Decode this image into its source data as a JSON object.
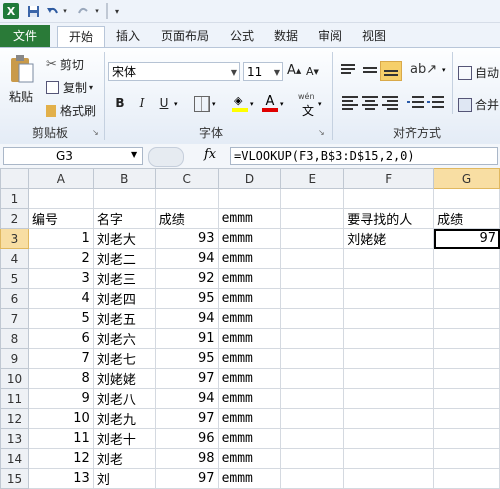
{
  "quick_access": {
    "logo": "X"
  },
  "tabs": [
    "文件",
    "开始",
    "插入",
    "页面布局",
    "公式",
    "数据",
    "审阅",
    "视图"
  ],
  "ribbon": {
    "clipboard": {
      "paste": "粘贴",
      "cut": "剪切",
      "copy": "复制",
      "format_painter": "格式刷",
      "group": "剪贴板"
    },
    "font": {
      "name": "宋体",
      "size": "11",
      "grow": "A",
      "shrink": "A",
      "bold": "B",
      "italic": "I",
      "underline": "U",
      "color_a": "A",
      "wen": "wén",
      "group": "字体"
    },
    "alignment": {
      "autowrap": "自动",
      "merge": "合并",
      "group": "对齐方式"
    }
  },
  "formula_bar": {
    "name_box": "G3",
    "fx": "fx",
    "formula": "=VLOOKUP(F3,B$3:D$15,2,0)"
  },
  "columns": [
    "A",
    "B",
    "C",
    "D",
    "E",
    "F",
    "G"
  ],
  "rows": [
    {
      "n": "1",
      "A": "",
      "B": "",
      "C": "",
      "D": "",
      "F": "",
      "G": ""
    },
    {
      "n": "2",
      "A": "编号",
      "B": "名字",
      "C": "成绩",
      "D": "emmm",
      "F": "要寻找的人",
      "G": "成绩"
    },
    {
      "n": "3",
      "A": "1",
      "B": "刘老大",
      "C": "93",
      "D": "emmm",
      "F": "刘姥姥",
      "G": "97"
    },
    {
      "n": "4",
      "A": "2",
      "B": "刘老二",
      "C": "94",
      "D": "emmm",
      "F": "",
      "G": ""
    },
    {
      "n": "5",
      "A": "3",
      "B": "刘老三",
      "C": "92",
      "D": "emmm",
      "F": "",
      "G": ""
    },
    {
      "n": "6",
      "A": "4",
      "B": "刘老四",
      "C": "95",
      "D": "emmm",
      "F": "",
      "G": ""
    },
    {
      "n": "7",
      "A": "5",
      "B": "刘老五",
      "C": "94",
      "D": "emmm",
      "F": "",
      "G": ""
    },
    {
      "n": "8",
      "A": "6",
      "B": "刘老六",
      "C": "91",
      "D": "emmm",
      "F": "",
      "G": ""
    },
    {
      "n": "9",
      "A": "7",
      "B": "刘老七",
      "C": "95",
      "D": "emmm",
      "F": "",
      "G": ""
    },
    {
      "n": "10",
      "A": "8",
      "B": "刘姥姥",
      "C": "97",
      "D": "emmm",
      "F": "",
      "G": ""
    },
    {
      "n": "11",
      "A": "9",
      "B": "刘老八",
      "C": "94",
      "D": "emmm",
      "F": "",
      "G": ""
    },
    {
      "n": "12",
      "A": "10",
      "B": "刘老九",
      "C": "97",
      "D": "emmm",
      "F": "",
      "G": ""
    },
    {
      "n": "13",
      "A": "11",
      "B": "刘老十",
      "C": "96",
      "D": "emmm",
      "F": "",
      "G": ""
    },
    {
      "n": "14",
      "A": "12",
      "B": "刘老",
      "C": "98",
      "D": "emmm",
      "F": "",
      "G": ""
    },
    {
      "n": "15",
      "A": "13",
      "B": "刘",
      "C": "97",
      "D": "emmm",
      "F": "",
      "G": ""
    }
  ]
}
